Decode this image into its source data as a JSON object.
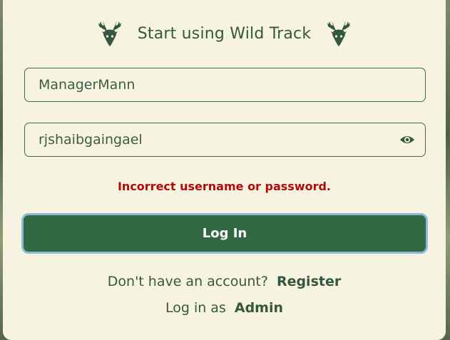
{
  "header": {
    "title": "Start using Wild Track",
    "left_icon": "deer-head-icon",
    "right_icon": "deer-head-icon"
  },
  "form": {
    "username_value": "ManagerMann",
    "password_value": "rjshaibgaingael",
    "password_toggle_icon": "eye-icon",
    "error_message": "Incorrect username or password.",
    "login_label": "Log In"
  },
  "footer": {
    "register_prompt": "Don't have an account?",
    "register_link": "Register",
    "admin_prompt": "Log in as",
    "admin_link": "Admin"
  },
  "colors": {
    "card_background": "#f7f3e1",
    "primary_green": "#316843",
    "text_green": "#35573f",
    "error_red": "#b00a0a",
    "focus_ring": "#8fb9d8"
  }
}
